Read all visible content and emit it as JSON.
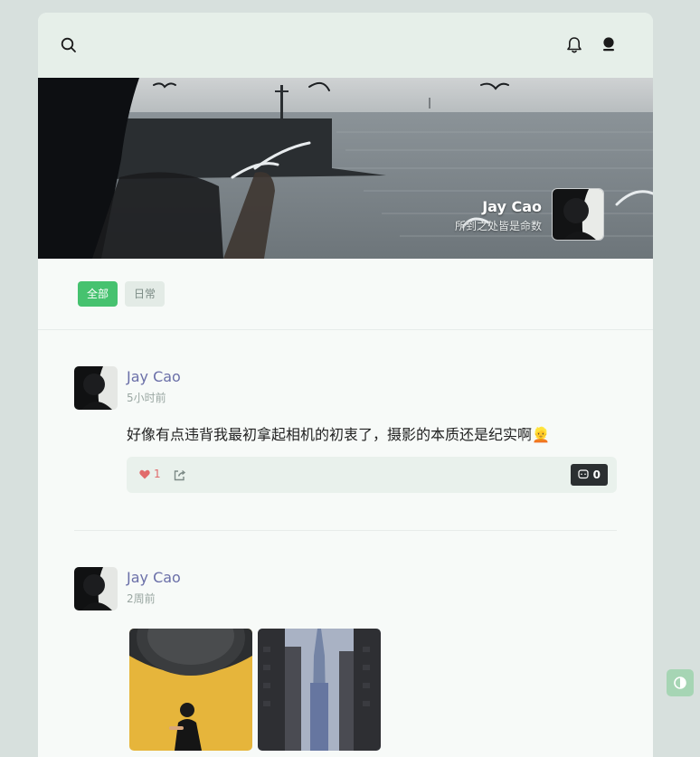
{
  "header": {
    "search_icon": "search-icon",
    "bell_icon": "bell-icon",
    "user_icon": "user-icon"
  },
  "profile": {
    "name": "Jay Cao",
    "signature": "所到之处皆是命数"
  },
  "filters": [
    {
      "label": "全部",
      "active": true
    },
    {
      "label": "日常",
      "active": false
    }
  ],
  "posts": [
    {
      "author": "Jay Cao",
      "time": "5小时前",
      "content": "好像有点违背我最初拿起相机的初衷了，摄影的本质还是纪实啊👱",
      "likes": "1",
      "comments": "0"
    },
    {
      "author": "Jay Cao",
      "time": "2周前"
    }
  ],
  "colors": {
    "accent": "#46c26f",
    "author_link": "#6a6fa8",
    "like": "#e16b6b",
    "header_bg": "#e6efe9",
    "page_bg": "#d7e0dd"
  }
}
